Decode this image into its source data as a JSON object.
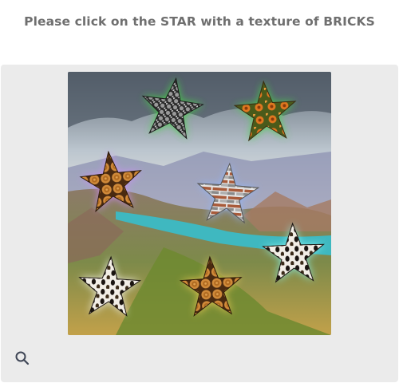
{
  "prompt": "Please click on the STAR with a texture of BRICKS",
  "canvas": {
    "scene": "canyon landscape with river under cloudy sky",
    "stars": [
      {
        "id": "star-1",
        "texture": "snakeskin",
        "glow": "#3fdc3f"
      },
      {
        "id": "star-2",
        "texture": "flowers",
        "glow": "#3fdc3f"
      },
      {
        "id": "star-3",
        "texture": "wood-logs",
        "glow": "#d18cff"
      },
      {
        "id": "star-4",
        "texture": "bricks",
        "glow": "#8fb6ff"
      },
      {
        "id": "star-5",
        "texture": "leopard",
        "glow": "#8af5f0"
      },
      {
        "id": "star-6",
        "texture": "leopard",
        "glow": "#ffffff"
      },
      {
        "id": "star-7",
        "texture": "wood-logs",
        "glow": "#ffd35a"
      }
    ]
  },
  "toolbar": {
    "search_icon": "search-icon"
  }
}
